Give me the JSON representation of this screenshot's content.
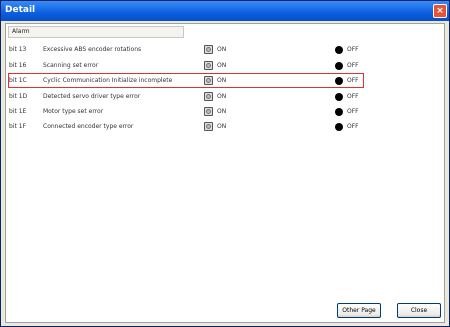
{
  "window": {
    "title": "Detail",
    "close_glyph": "×"
  },
  "alarm_header": "Alarm",
  "rows": [
    {
      "bit": "bit 13",
      "desc": "Excessive ABS encoder rotations",
      "on": "ON",
      "off": "OFF"
    },
    {
      "bit": "bit 16",
      "desc": "Scanning set error",
      "on": "ON",
      "off": "OFF"
    },
    {
      "bit": "bit 1C",
      "desc": "Cyclic Communication Initialize incomplete",
      "on": "ON",
      "off": "OFF"
    },
    {
      "bit": "bit 1D",
      "desc": "Detected servo driver type error",
      "on": "ON",
      "off": "OFF"
    },
    {
      "bit": "bit 1E",
      "desc": "Motor type set error",
      "on": "ON",
      "off": "OFF"
    },
    {
      "bit": "bit 1F",
      "desc": "Connected encoder type error",
      "on": "ON",
      "off": "OFF"
    }
  ],
  "buttons": {
    "other_page": "Other Page",
    "close": "Close"
  },
  "colors": {
    "highlight": "#e03030",
    "title_bar": "#0a5ee0"
  }
}
